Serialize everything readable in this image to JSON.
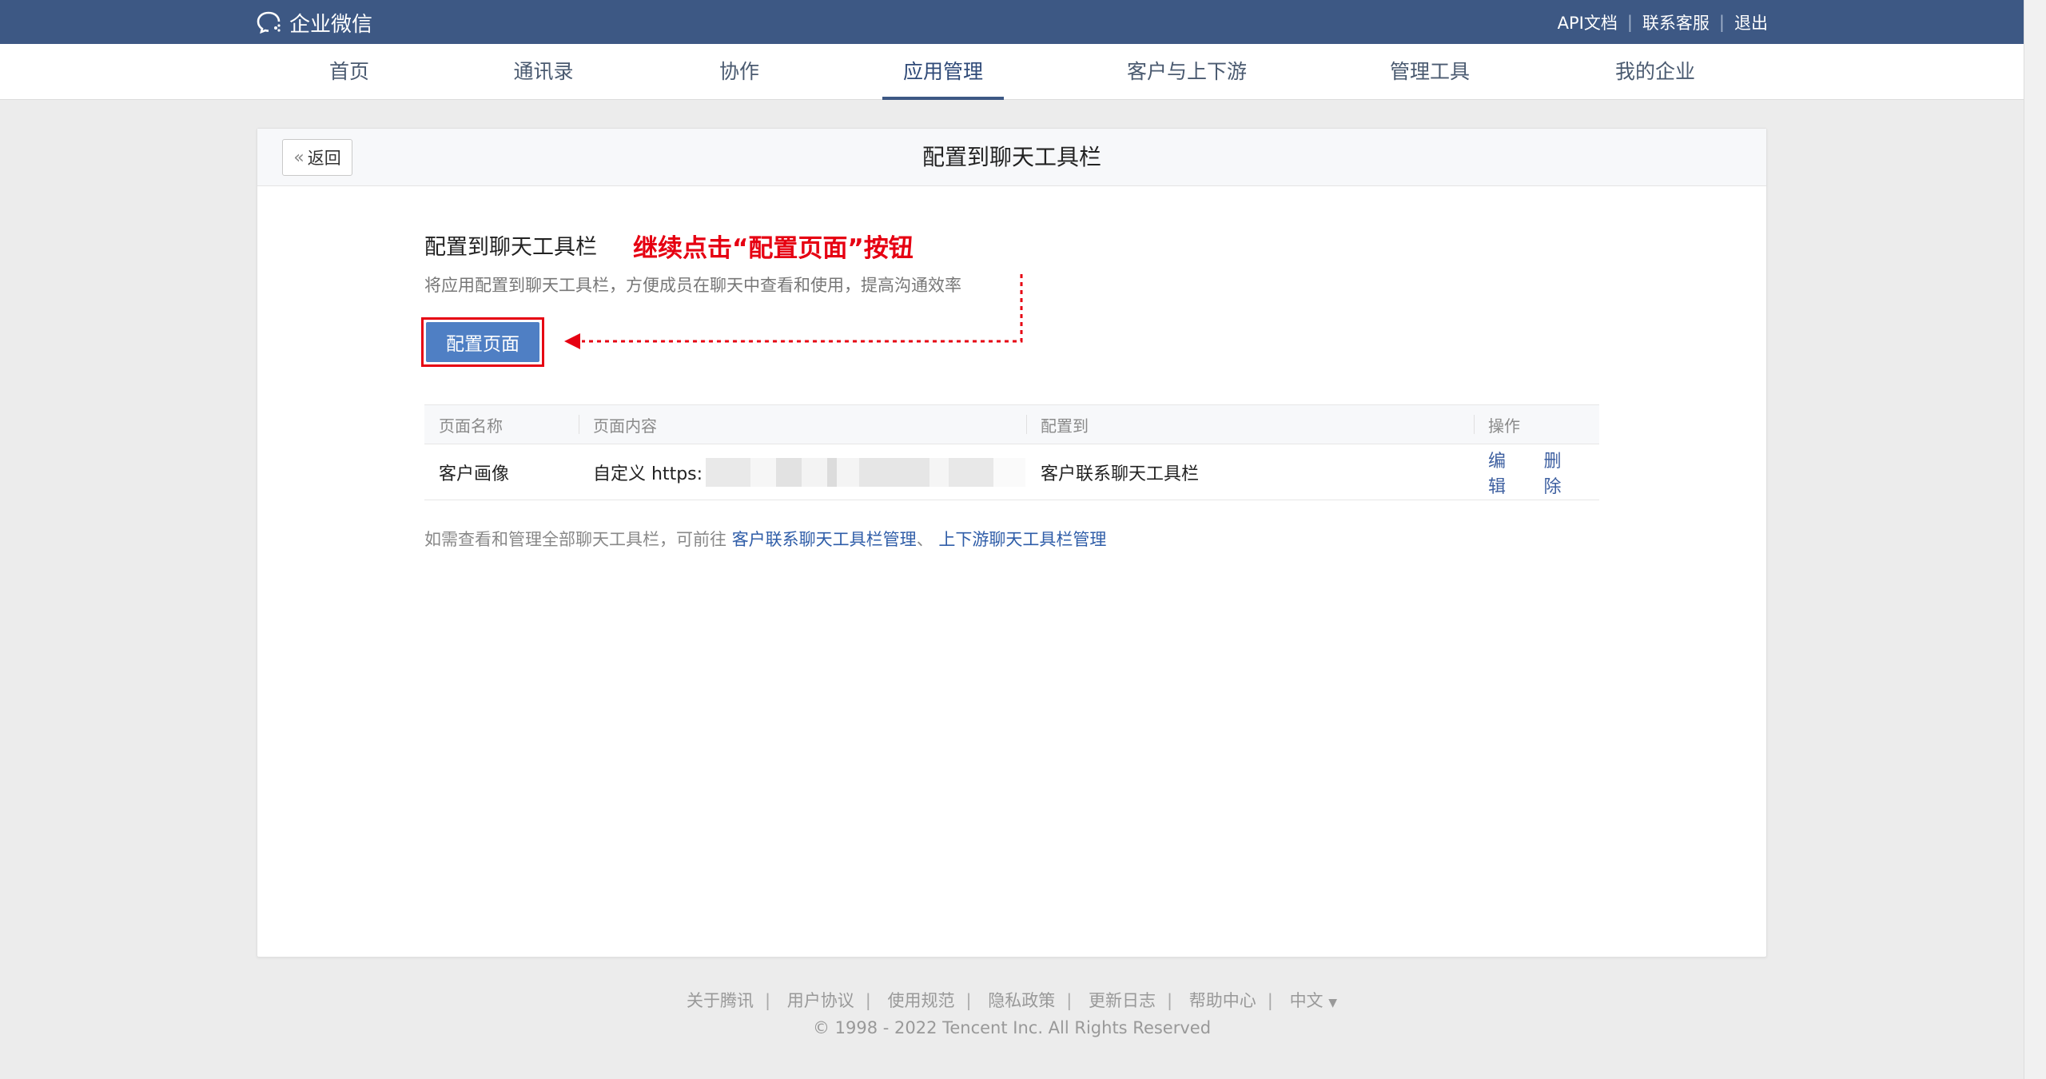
{
  "brand": {
    "name": "企业微信"
  },
  "top_links": [
    "API文档",
    "联系客服",
    "退出"
  ],
  "nav": {
    "items": [
      "首页",
      "通讯录",
      "协作",
      "应用管理",
      "客户与上下游",
      "管理工具",
      "我的企业"
    ],
    "active": "应用管理"
  },
  "card": {
    "back_label": "返回",
    "title": "配置到聊天工具栏"
  },
  "section": {
    "title": "配置到聊天工具栏",
    "annotation": "继续点击“配置页面”按钮",
    "description": "将应用配置到聊天工具栏，方便成员在聊天中查看和使用，提高沟通效率",
    "config_button": "配置页面"
  },
  "table": {
    "headers": [
      "页面名称",
      "页面内容",
      "配置到",
      "操作"
    ],
    "rows": [
      {
        "name": "客户画像",
        "content_prefix": "自定义 https:",
        "target": "客户联系聊天工具栏",
        "actions": [
          "编辑",
          "删除"
        ]
      }
    ]
  },
  "note": {
    "text": "如需查看和管理全部聊天工具栏，可前往",
    "link1": "客户联系聊天工具栏管理",
    "separator": "、",
    "link2": "上下游聊天工具栏管理"
  },
  "footer": {
    "links": [
      "关于腾讯",
      "用户协议",
      "使用规范",
      "隐私政策",
      "更新日志",
      "帮助中心",
      "中文"
    ],
    "language_caret": "▼",
    "copyright": "© 1998 - 2022 Tencent Inc. All Rights Reserved"
  },
  "colors": {
    "topbar": "#3d5884",
    "accent_button": "#4f7fc4",
    "annotation_red": "#e60012",
    "link": "#2f5da8"
  }
}
